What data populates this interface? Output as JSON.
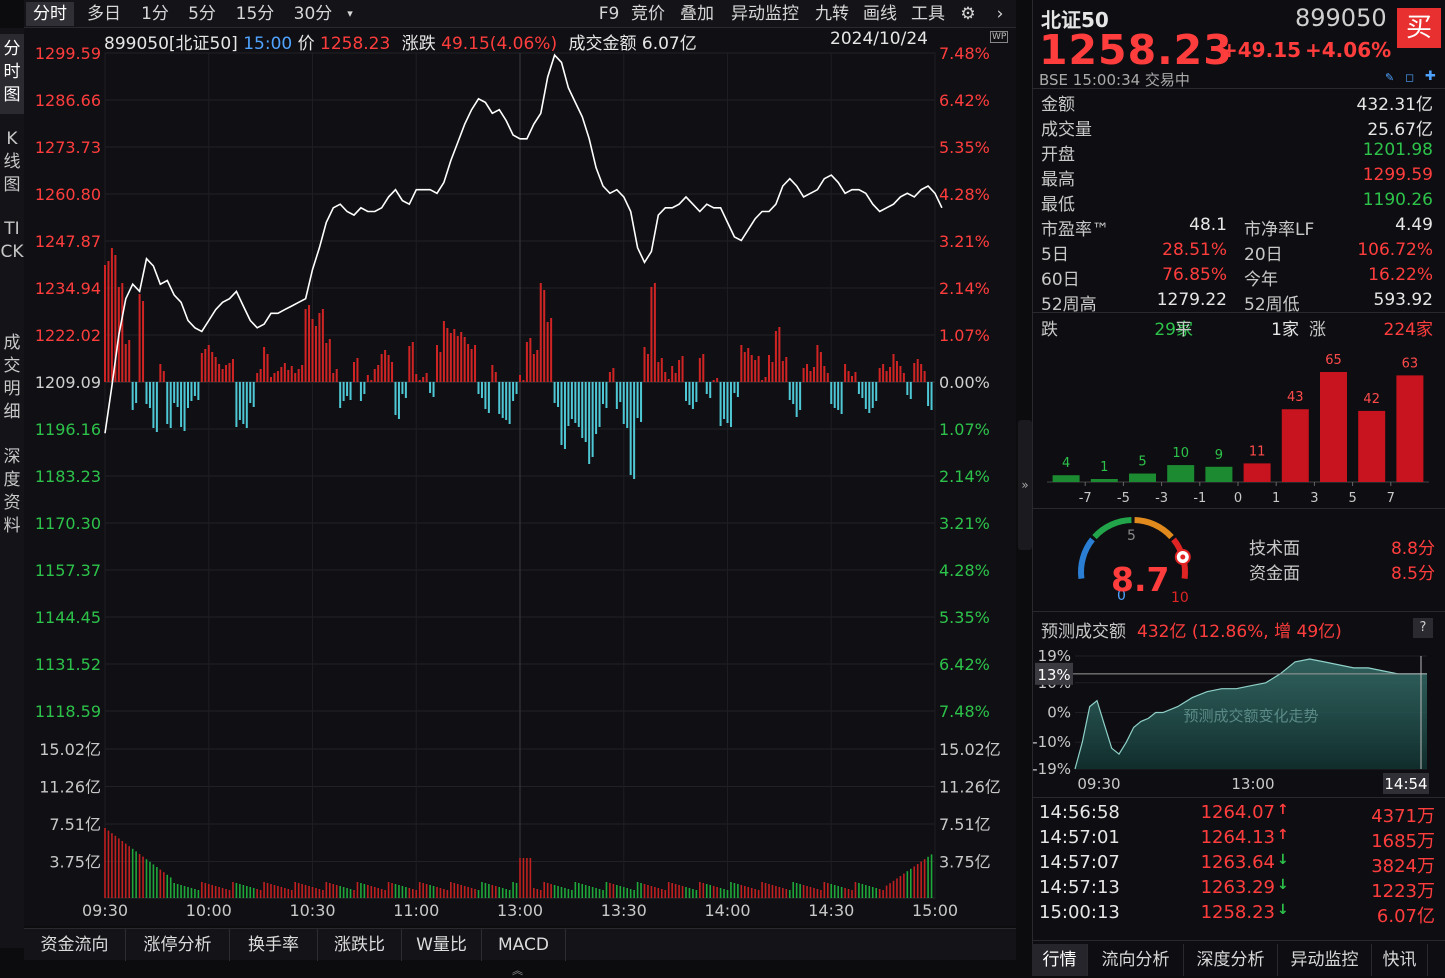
{
  "toolbar": {
    "left_tabs": [
      "分时",
      "多日",
      "1分",
      "5分",
      "15分",
      "30分"
    ],
    "right_tabs": [
      "F9",
      "竞价",
      "叠加",
      "异动监控",
      "九转",
      "画线",
      "工具"
    ]
  },
  "vertical_tabs": [
    "分时图",
    "K线图",
    "TICK",
    "成交明细",
    "深度资料"
  ],
  "info_bar": {
    "code": "899050[北证50]",
    "time": "15:00",
    "price_label": "价",
    "price": "1258.23",
    "change_label": "涨跌",
    "change": "49.15(4.06%)",
    "turnover_label": "成交金额",
    "turnover": "6.07亿",
    "date": "2024/10/24",
    "wp": "WP"
  },
  "chart_data": {
    "type": "line",
    "prev_close": 1209.09,
    "ylim": [
      1118.59,
      1299.59
    ],
    "y_ticks_left": [
      "1299.59",
      "1286.66",
      "1273.73",
      "1260.80",
      "1247.87",
      "1234.94",
      "1222.02",
      "1209.09",
      "1196.16",
      "1183.23",
      "1170.30",
      "1157.37",
      "1144.45",
      "1131.52",
      "1118.59"
    ],
    "y_ticks_right": [
      "7.48%",
      "6.42%",
      "5.35%",
      "4.28%",
      "3.21%",
      "2.14%",
      "1.07%",
      "0.00%",
      "1.07%",
      "2.14%",
      "3.21%",
      "4.28%",
      "5.35%",
      "6.42%",
      "7.48%"
    ],
    "x_ticks": [
      "09:30",
      "10:00",
      "10:30",
      "11:00",
      "13:00",
      "13:30",
      "14:00",
      "14:30",
      "15:00"
    ],
    "price_series": [
      [
        0,
        1195
      ],
      [
        2,
        1208
      ],
      [
        4,
        1222
      ],
      [
        6,
        1232
      ],
      [
        8,
        1236
      ],
      [
        10,
        1234
      ],
      [
        12,
        1243
      ],
      [
        14,
        1241
      ],
      [
        16,
        1236
      ],
      [
        18,
        1237
      ],
      [
        20,
        1233
      ],
      [
        22,
        1231
      ],
      [
        24,
        1226
      ],
      [
        26,
        1224
      ],
      [
        28,
        1223
      ],
      [
        30,
        1226
      ],
      [
        32,
        1229
      ],
      [
        34,
        1231
      ],
      [
        36,
        1232
      ],
      [
        38,
        1234
      ],
      [
        40,
        1230
      ],
      [
        42,
        1226
      ],
      [
        44,
        1224
      ],
      [
        46,
        1225
      ],
      [
        48,
        1228
      ],
      [
        50,
        1228
      ],
      [
        52,
        1229
      ],
      [
        54,
        1230
      ],
      [
        56,
        1231
      ],
      [
        58,
        1232
      ],
      [
        60,
        1240
      ],
      [
        62,
        1246
      ],
      [
        64,
        1253
      ],
      [
        66,
        1257
      ],
      [
        68,
        1258
      ],
      [
        70,
        1256
      ],
      [
        72,
        1255
      ],
      [
        74,
        1257
      ],
      [
        76,
        1256
      ],
      [
        78,
        1256
      ],
      [
        80,
        1257
      ],
      [
        82,
        1260
      ],
      [
        84,
        1262
      ],
      [
        86,
        1259
      ],
      [
        88,
        1258
      ],
      [
        90,
        1262
      ],
      [
        92,
        1262
      ],
      [
        94,
        1262
      ],
      [
        96,
        1261
      ],
      [
        98,
        1264
      ],
      [
        100,
        1270
      ],
      [
        102,
        1275
      ],
      [
        104,
        1280
      ],
      [
        106,
        1284
      ],
      [
        108,
        1287
      ],
      [
        110,
        1286
      ],
      [
        112,
        1283
      ],
      [
        114,
        1284
      ],
      [
        116,
        1281
      ],
      [
        118,
        1277
      ],
      [
        120,
        1276
      ],
      [
        122,
        1276
      ],
      [
        124,
        1280
      ],
      [
        126,
        1283
      ],
      [
        128,
        1293
      ],
      [
        130,
        1299
      ],
      [
        132,
        1297
      ],
      [
        134,
        1290
      ],
      [
        136,
        1286
      ],
      [
        138,
        1282
      ],
      [
        140,
        1276
      ],
      [
        142,
        1268
      ],
      [
        144,
        1263
      ],
      [
        146,
        1261
      ],
      [
        148,
        1262
      ],
      [
        150,
        1260
      ],
      [
        152,
        1256
      ],
      [
        154,
        1246
      ],
      [
        156,
        1242
      ],
      [
        158,
        1245
      ],
      [
        160,
        1255
      ],
      [
        162,
        1257
      ],
      [
        164,
        1257
      ],
      [
        166,
        1258
      ],
      [
        168,
        1260
      ],
      [
        170,
        1258
      ],
      [
        172,
        1256
      ],
      [
        174,
        1258
      ],
      [
        176,
        1257
      ],
      [
        178,
        1257
      ],
      [
        180,
        1253
      ],
      [
        182,
        1249
      ],
      [
        184,
        1248
      ],
      [
        186,
        1251
      ],
      [
        188,
        1254
      ],
      [
        190,
        1256
      ],
      [
        192,
        1256
      ],
      [
        194,
        1258
      ],
      [
        196,
        1263
      ],
      [
        198,
        1265
      ],
      [
        200,
        1263
      ],
      [
        202,
        1260
      ],
      [
        204,
        1261
      ],
      [
        206,
        1262
      ],
      [
        208,
        1265
      ],
      [
        210,
        1266
      ],
      [
        212,
        1264
      ],
      [
        214,
        1261
      ],
      [
        216,
        1262
      ],
      [
        218,
        1262
      ],
      [
        220,
        1261
      ],
      [
        222,
        1258
      ],
      [
        224,
        1256
      ],
      [
        226,
        1257
      ],
      [
        228,
        1258
      ],
      [
        230,
        1260
      ],
      [
        232,
        1261
      ],
      [
        234,
        1260
      ],
      [
        236,
        1262
      ],
      [
        238,
        1263
      ],
      [
        240,
        1261
      ],
      [
        242,
        1257
      ]
    ],
    "volume_ticks": [
      "15.02亿",
      "11.26亿",
      "7.51亿",
      "3.75亿"
    ]
  },
  "bottom_tabs": [
    "资金流向",
    "涨停分析",
    "换手率",
    "涨跌比",
    "W量比",
    "MACD"
  ],
  "quote": {
    "name": "北证50",
    "code": "899050",
    "buy": "买",
    "price": "1258.23",
    "change": "+49.15",
    "change_pct": "+4.06%",
    "exchange_time": "BSE  15:00:34  交易中",
    "stats": [
      {
        "label": "金额",
        "value": "432.31亿",
        "color": "white"
      },
      {
        "label": "成交量",
        "value": "25.67亿",
        "color": "white"
      },
      {
        "label": "开盘",
        "value": "1201.98",
        "color": "green"
      },
      {
        "label": "最高",
        "value": "1299.59",
        "color": "red"
      },
      {
        "label": "最低",
        "value": "1190.26",
        "color": "green"
      }
    ],
    "grid": [
      {
        "l1": "市盈率™",
        "v1": "48.1",
        "c1": "white",
        "l2": "市净率LF",
        "v2": "4.49",
        "c2": "white"
      },
      {
        "l1": "5日",
        "v1": "28.51%",
        "c1": "red",
        "l2": "20日",
        "v2": "106.72%",
        "c2": "red"
      },
      {
        "l1": "60日",
        "v1": "76.85%",
        "c1": "red",
        "l2": "今年",
        "v2": "16.22%",
        "c2": "red"
      },
      {
        "l1": "52周高",
        "v1": "1279.22",
        "c1": "white",
        "l2": "52周低",
        "v2": "593.92",
        "c2": "white"
      }
    ],
    "breadth": {
      "fall_label": "跌",
      "fall": "29家",
      "flat_label": "平",
      "flat": "1家",
      "rise_label": "涨",
      "rise": "224家"
    }
  },
  "distribution": {
    "categories": [
      "-7",
      "-5",
      "-3",
      "-1",
      "0",
      "1",
      "3",
      "5",
      "7"
    ],
    "bars": [
      {
        "label": "4",
        "value": 4,
        "color": "green"
      },
      {
        "label": "1",
        "value": 1,
        "color": "green"
      },
      {
        "label": "5",
        "value": 5,
        "color": "green"
      },
      {
        "label": "10",
        "value": 10,
        "color": "green"
      },
      {
        "label": "9",
        "value": 9,
        "color": "green"
      },
      {
        "label": "11",
        "value": 11,
        "color": "red"
      },
      {
        "label": "43",
        "value": 43,
        "color": "red"
      },
      {
        "label": "65",
        "value": 65,
        "color": "red"
      },
      {
        "label": "42",
        "value": 42,
        "color": "red"
      },
      {
        "label": "63",
        "value": 63,
        "color": "red"
      }
    ]
  },
  "gauge": {
    "score": "8.7",
    "score_value": 8.7,
    "min": "0",
    "mid": "5",
    "max": "10",
    "tech_label": "技术面",
    "tech_score": "8.8分",
    "fund_label": "资金面",
    "fund_score": "8.5分"
  },
  "forecast": {
    "label": "预测成交额",
    "value": "432亿 (12.86%, 增 49亿)",
    "help": "?",
    "y_ticks": [
      "19%",
      "10%",
      "0%",
      "-10%",
      "-19%"
    ],
    "current": "13%",
    "x_ticks": [
      "09:30",
      "13:00"
    ],
    "x_current": "14:54",
    "watermark": "预测成交额变化走势",
    "series": [
      [
        0,
        -19
      ],
      [
        5,
        -10
      ],
      [
        10,
        2
      ],
      [
        15,
        4
      ],
      [
        20,
        -4
      ],
      [
        25,
        -12
      ],
      [
        30,
        -14
      ],
      [
        35,
        -10
      ],
      [
        40,
        -5
      ],
      [
        45,
        -3
      ],
      [
        50,
        -2
      ],
      [
        55,
        0
      ],
      [
        60,
        0
      ],
      [
        70,
        2
      ],
      [
        80,
        5
      ],
      [
        90,
        7
      ],
      [
        100,
        8
      ],
      [
        110,
        8
      ],
      [
        120,
        9
      ],
      [
        130,
        10
      ],
      [
        140,
        13
      ],
      [
        150,
        17
      ],
      [
        160,
        18
      ],
      [
        170,
        17
      ],
      [
        180,
        16
      ],
      [
        190,
        15
      ],
      [
        200,
        15
      ],
      [
        210,
        14
      ],
      [
        220,
        13
      ],
      [
        230,
        13
      ],
      [
        240,
        13
      ]
    ]
  },
  "ticks": [
    {
      "time": "14:56:58",
      "price": "1264.07",
      "dir": "up",
      "vol": "4371万"
    },
    {
      "time": "14:57:01",
      "price": "1264.13",
      "dir": "up",
      "vol": "1685万"
    },
    {
      "time": "14:57:07",
      "price": "1263.64",
      "dir": "down",
      "vol": "3824万"
    },
    {
      "time": "14:57:13",
      "price": "1263.29",
      "dir": "down",
      "vol": "1223万"
    },
    {
      "time": "15:00:13",
      "price": "1258.23",
      "dir": "down",
      "vol": "6.07亿"
    }
  ],
  "bottom_nav": [
    "行情",
    "流向分析",
    "深度分析",
    "异动监控",
    "快讯"
  ],
  "colors": {
    "up": "#ff3d3d",
    "down": "#2dc24a",
    "line": "#ffffff",
    "cyan": "#4fc8d6",
    "bg": "#0c0c0f"
  }
}
